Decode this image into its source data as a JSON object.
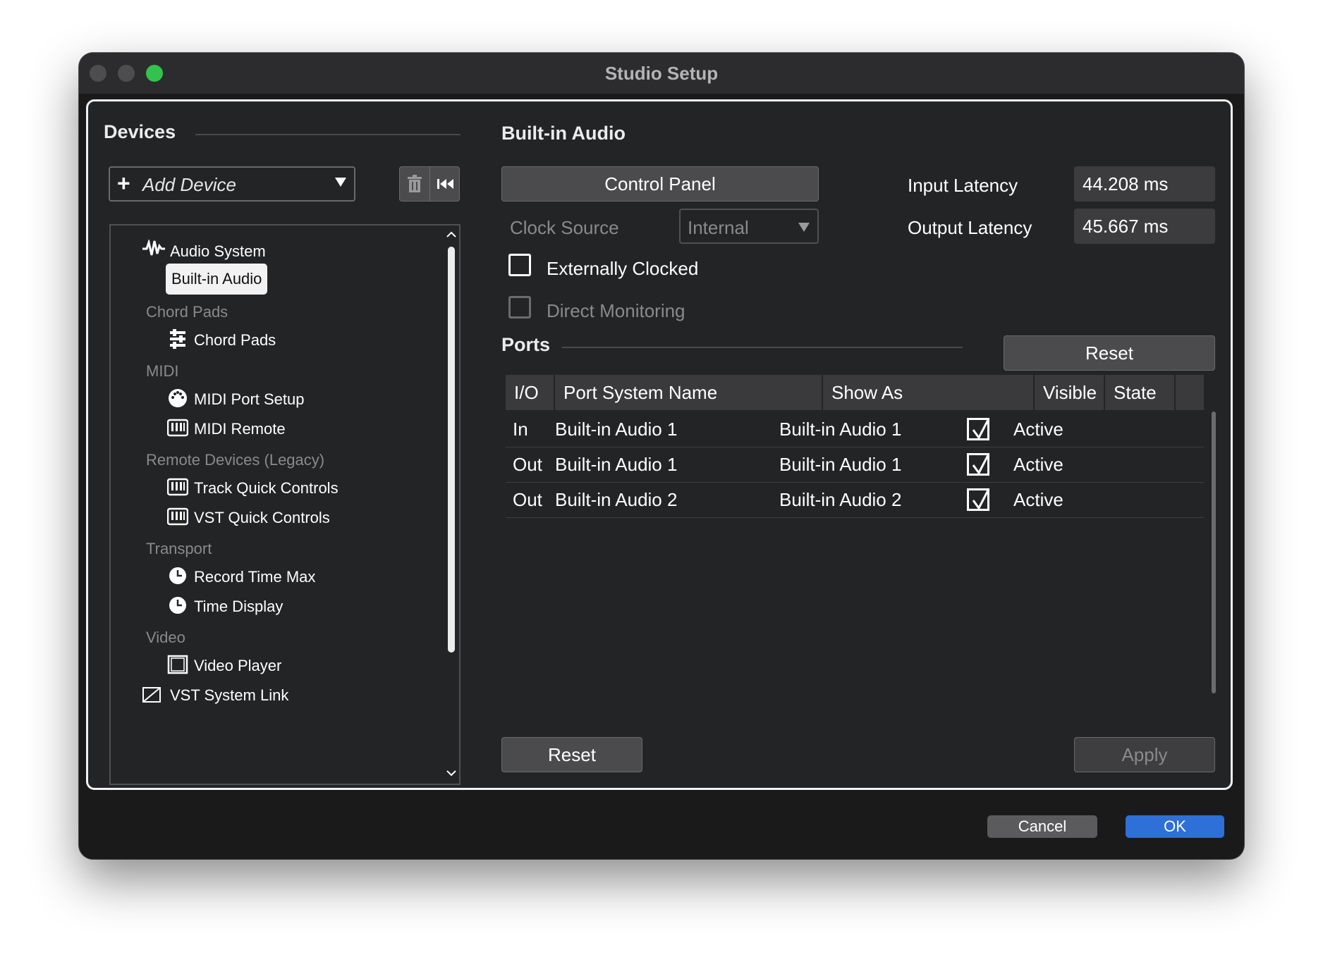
{
  "window": {
    "title": "Studio Setup"
  },
  "devices": {
    "title": "Devices",
    "add_device": "Add Device",
    "tree": [
      {
        "kind": "group",
        "label": "Audio System",
        "icon": "waveform-icon"
      },
      {
        "kind": "item",
        "label": "Built-in Audio",
        "selected": true
      },
      {
        "kind": "category",
        "label": "Chord Pads"
      },
      {
        "kind": "item",
        "label": "Chord Pads",
        "icon": "chord-pads-icon"
      },
      {
        "kind": "category",
        "label": "MIDI"
      },
      {
        "kind": "item",
        "label": "MIDI Port Setup",
        "icon": "midi-port-icon"
      },
      {
        "kind": "item",
        "label": "MIDI Remote",
        "icon": "keyboard-icon"
      },
      {
        "kind": "category",
        "label": "Remote Devices (Legacy)"
      },
      {
        "kind": "item",
        "label": "Track Quick Controls",
        "icon": "keyboard-icon"
      },
      {
        "kind": "item",
        "label": "VST Quick Controls",
        "icon": "keyboard-icon"
      },
      {
        "kind": "category",
        "label": "Transport"
      },
      {
        "kind": "item",
        "label": "Record Time Max",
        "icon": "clock-icon"
      },
      {
        "kind": "item",
        "label": "Time Display",
        "icon": "clock-icon"
      },
      {
        "kind": "category",
        "label": "Video"
      },
      {
        "kind": "item",
        "label": "Video Player",
        "icon": "film-icon"
      },
      {
        "kind": "group",
        "label": "VST System Link",
        "icon": "link-icon"
      }
    ]
  },
  "detail": {
    "title": "Built-in Audio",
    "control_panel": "Control Panel",
    "clock_source_label": "Clock Source",
    "clock_source_value": "Internal",
    "externally_clocked": "Externally Clocked",
    "direct_monitoring": "Direct Monitoring",
    "input_latency_label": "Input Latency",
    "input_latency_value": "44.208 ms",
    "output_latency_label": "Output Latency",
    "output_latency_value": "45.667 ms",
    "ports_title": "Ports",
    "ports_reset": "Reset",
    "bottom_reset": "Reset",
    "apply": "Apply"
  },
  "ports_table": {
    "headers": [
      "I/O",
      "Port System Name",
      "Show As",
      "Visible",
      "State"
    ],
    "rows": [
      {
        "io": "In",
        "system_name": "Built-in Audio 1",
        "show_as": "Built-in Audio 1",
        "visible": true,
        "state": "Active"
      },
      {
        "io": "Out",
        "system_name": "Built-in Audio 1",
        "show_as": "Built-in Audio 1",
        "visible": true,
        "state": "Active"
      },
      {
        "io": "Out",
        "system_name": "Built-in Audio 2",
        "show_as": "Built-in Audio 2",
        "visible": true,
        "state": "Active"
      }
    ]
  },
  "footer": {
    "cancel": "Cancel",
    "ok": "OK"
  },
  "colors": {
    "accent": "#2f6fd8",
    "zoom": "#32c24d"
  }
}
